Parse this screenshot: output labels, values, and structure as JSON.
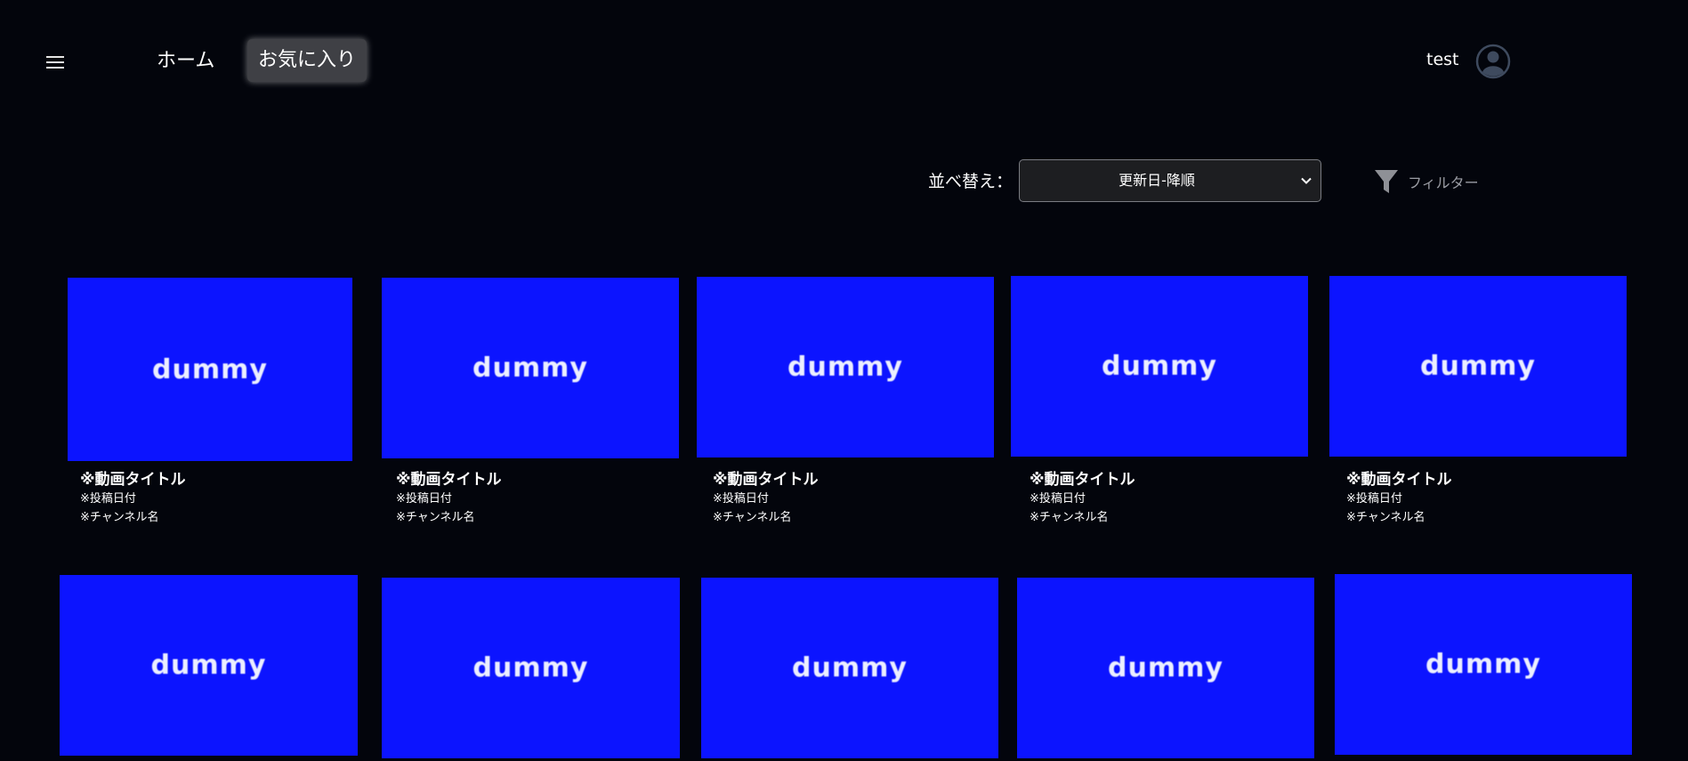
{
  "header": {
    "menu_icon": "hamburger-menu-icon",
    "nav": [
      {
        "label": "ホーム",
        "active": false
      },
      {
        "label": "お気に入り",
        "active": true
      }
    ],
    "username": "test",
    "avatar_icon": "user-circle-icon"
  },
  "toolbar": {
    "sort_label": "並べ替え：",
    "sort_value": "更新日-降順",
    "filter_label": "フィルター",
    "filter_icon": "funnel-icon"
  },
  "thumbnail_color": "#0c14ff",
  "videos": [
    {
      "thumb": "dummy",
      "title": "※動画タイトル",
      "date": "※投稿日付",
      "channel": "※チャンネル名"
    },
    {
      "thumb": "dummy",
      "title": "※動画タイトル",
      "date": "※投稿日付",
      "channel": "※チャンネル名"
    },
    {
      "thumb": "dummy",
      "title": "※動画タイトル",
      "date": "※投稿日付",
      "channel": "※チャンネル名"
    },
    {
      "thumb": "dummy",
      "title": "※動画タイトル",
      "date": "※投稿日付",
      "channel": "※チャンネル名"
    },
    {
      "thumb": "dummy",
      "title": "※動画タイトル",
      "date": "※投稿日付",
      "channel": "※チャンネル名"
    },
    {
      "thumb": "dummy"
    },
    {
      "thumb": "dummy"
    },
    {
      "thumb": "dummy"
    },
    {
      "thumb": "dummy"
    },
    {
      "thumb": "dummy"
    }
  ]
}
